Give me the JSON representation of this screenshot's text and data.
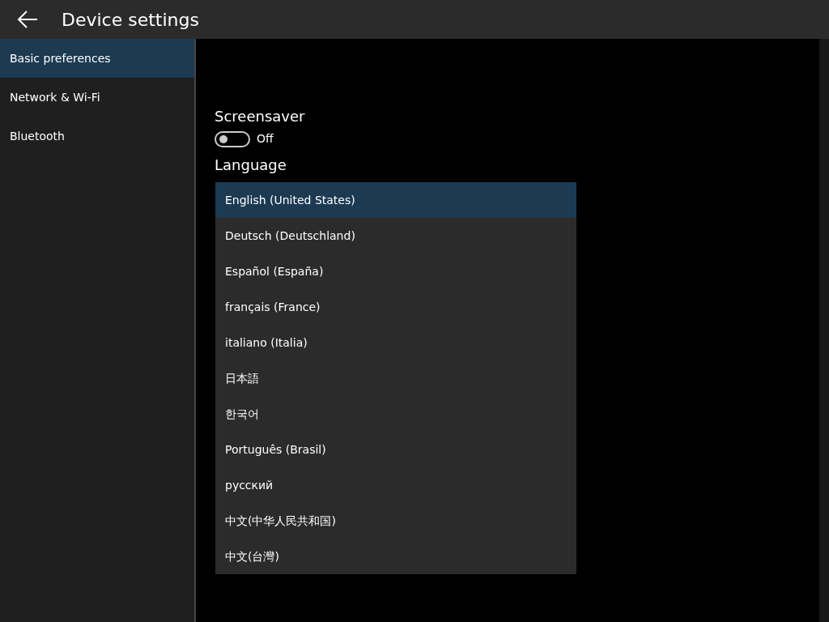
{
  "header": {
    "title": "Device settings"
  },
  "sidebar": {
    "items": [
      {
        "label": "Basic preferences",
        "selected": true
      },
      {
        "label": "Network & Wi-Fi",
        "selected": false
      },
      {
        "label": "Bluetooth",
        "selected": false
      }
    ]
  },
  "screensaver": {
    "label": "Screensaver",
    "on": false,
    "state_text": "Off"
  },
  "language": {
    "label": "Language",
    "options": [
      {
        "label": "English (United States)",
        "selected": true
      },
      {
        "label": "Deutsch (Deutschland)",
        "selected": false
      },
      {
        "label": "Español (España)",
        "selected": false
      },
      {
        "label": "français (France)",
        "selected": false
      },
      {
        "label": "italiano (Italia)",
        "selected": false
      },
      {
        "label": "日本語",
        "selected": false
      },
      {
        "label": "한국어",
        "selected": false
      },
      {
        "label": "Português (Brasil)",
        "selected": false
      },
      {
        "label": "русский",
        "selected": false
      },
      {
        "label": "中文(中华人民共和国)",
        "selected": false
      },
      {
        "label": "中文(台灣)",
        "selected": false
      }
    ]
  }
}
